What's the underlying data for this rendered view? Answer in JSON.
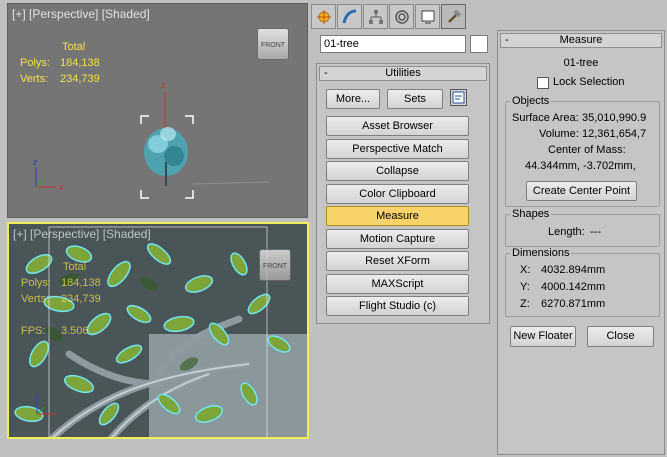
{
  "viewports": {
    "top": {
      "label": "[+] [Perspective] [Shaded]",
      "stats": {
        "total_label": "Total",
        "polys_label": "Polys:",
        "polys_value": "184,138",
        "verts_label": "Verts:",
        "verts_value": "234,739"
      },
      "viewcube_label": "FRONT"
    },
    "bottom": {
      "label": "[+] [Perspective] [Shaded]",
      "stats": {
        "total_label": "Total",
        "polys_label": "Polys:",
        "polys_value": "184,138",
        "verts_label": "Verts:",
        "verts_value": "234,739",
        "fps_label": "FPS:",
        "fps_value": "3.506"
      },
      "viewcube_label": "FRONT"
    }
  },
  "command_panel": {
    "tabs": [
      {
        "icon": "create-icon"
      },
      {
        "icon": "modify-icon"
      },
      {
        "icon": "hierarchy-icon"
      },
      {
        "icon": "motion-icon"
      },
      {
        "icon": "display-icon"
      },
      {
        "icon": "utilities-icon",
        "active": true
      }
    ],
    "object_name": "01-tree",
    "color_swatch": "#ffffff",
    "utilities": {
      "title": "Utilities",
      "collapse_symbol": "-",
      "more_label": "More...",
      "sets_label": "Sets",
      "buttons": [
        "Asset Browser",
        "Perspective Match",
        "Collapse",
        "Color Clipboard",
        "Measure",
        "Motion Capture",
        "Reset XForm",
        "MAXScript",
        "Flight Studio (c)"
      ],
      "active_button": "Measure"
    }
  },
  "measure": {
    "title": "Measure",
    "collapse_symbol": "-",
    "object_name": "01-tree",
    "lock_selection_label": "Lock Selection",
    "lock_selection_checked": false,
    "objects_group": {
      "title": "Objects",
      "surface_area_label": "Surface Area:",
      "surface_area_value": "35,010,990.9",
      "volume_label": "Volume:",
      "volume_value": "12,361,654,7",
      "center_of_mass_label": "Center of Mass:",
      "center_of_mass_value": "44.344mm, -3.702mm,",
      "create_center_point_label": "Create Center Point"
    },
    "shapes_group": {
      "title": "Shapes",
      "length_label": "Length:",
      "length_value": "---"
    },
    "dimensions_group": {
      "title": "Dimensions",
      "x_label": "X:",
      "x_value": "4032.894mm",
      "y_label": "Y:",
      "y_value": "4000.142mm",
      "z_label": "Z:",
      "z_value": "6270.871mm"
    },
    "new_floater_label": "New Floater",
    "close_label": "Close"
  },
  "axis_labels": {
    "x": "x",
    "y": "y",
    "z": "z"
  }
}
